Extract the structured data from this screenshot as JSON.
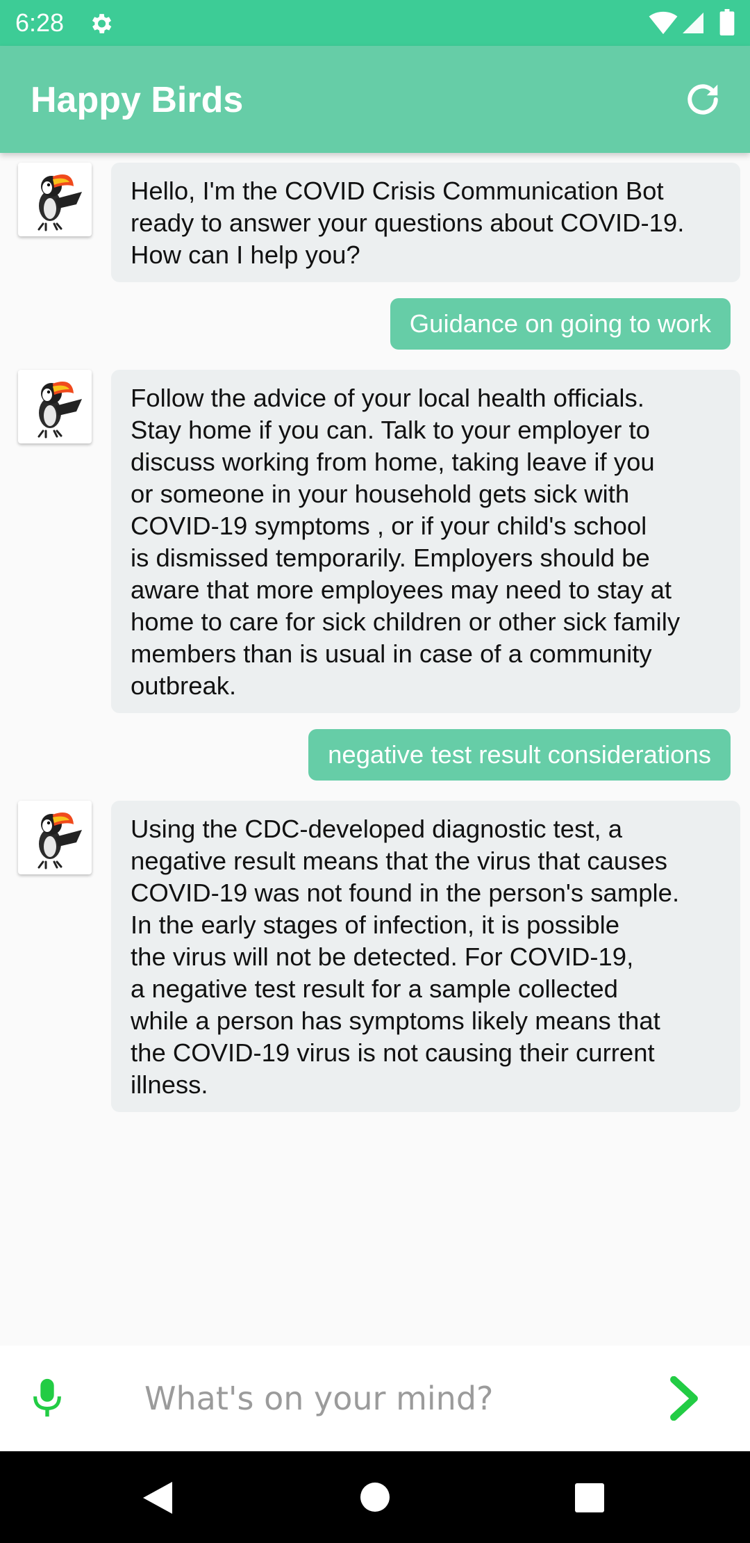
{
  "status_bar": {
    "time": "6:28",
    "icons": [
      "settings-gear-icon",
      "wifi-icon",
      "cell-signal-icon",
      "battery-icon"
    ]
  },
  "app_bar": {
    "title": "Happy Birds",
    "refresh_icon": "refresh-icon"
  },
  "chat": {
    "messages": [
      {
        "sender": "bot",
        "avatar": "toucan-avatar",
        "text": "Hello, I'm the COVID Crisis Communication Bot\nready to answer your questions about COVID-19.\nHow can I help you?"
      },
      {
        "sender": "user",
        "text": "Guidance on going to work"
      },
      {
        "sender": "bot",
        "avatar": "toucan-avatar",
        "text": "Follow the advice of your local health officials.\nStay home if you can. Talk to your employer to\ndiscuss working from home, taking leave if you\nor someone in your household gets sick with\nCOVID-19 symptoms , or if your child's school\nis dismissed temporarily. Employers should be\naware that more employees may need to stay at\nhome to care for sick children or other sick family\nmembers than is usual in case of a community\noutbreak."
      },
      {
        "sender": "user",
        "text": "negative test result considerations"
      },
      {
        "sender": "bot",
        "avatar": "toucan-avatar",
        "text": "Using the CDC-developed diagnostic test, a\nnegative result means that the virus that causes\nCOVID-19 was not found in the person's sample.\nIn the early stages of infection, it is possible\nthe virus will not be detected. For COVID-19,\na negative test result for a sample collected\nwhile a person has symptoms likely means that\nthe COVID-19 virus is not causing their current\nillness."
      }
    ]
  },
  "input_bar": {
    "mic_icon": "microphone-icon",
    "placeholder": "What's on your mind?",
    "value": "",
    "send_icon": "chevron-right-send-icon"
  },
  "nav_bar": {
    "icons": [
      "back-triangle-icon",
      "home-circle-icon",
      "recents-square-icon"
    ]
  },
  "colors": {
    "status_bar": "#3dcc96",
    "app_bar": "#66cda7",
    "user_bubble": "#66cda7",
    "bot_bubble": "#eceff0",
    "background": "#fafafa",
    "accent_green": "#22cc44"
  }
}
